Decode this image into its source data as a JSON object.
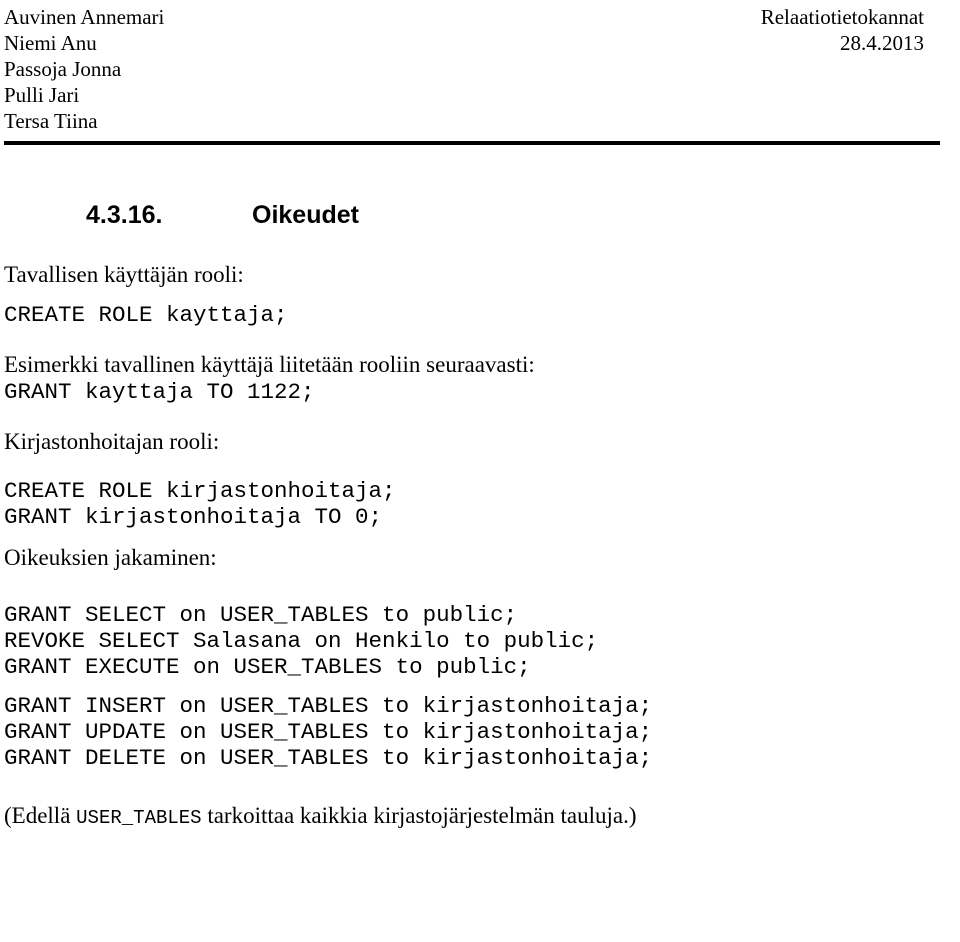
{
  "header": {
    "authors": [
      "Auvinen Annemari",
      "Niemi Anu",
      "Passoja Jonna",
      "Pulli Jari",
      "Tersa Tiina"
    ],
    "course": "Relaatiotietokannat",
    "date": "28.4.2013"
  },
  "section": {
    "number": "4.3.16.",
    "title": "Oikeudet"
  },
  "body": {
    "label_basic_user_role": "Tavallisen käyttäjän rooli:",
    "code_create_role_kayttaja": "CREATE ROLE kayttaja;",
    "label_example_attach": "Esimerkki tavallinen käyttäjä liitetään rooliin seuraavasti:",
    "code_grant_kayttaja": "GRANT kayttaja TO 1122;",
    "label_librarian_role": "Kirjastonhoitajan rooli:",
    "code_create_role_kirjastonhoitaja": "CREATE ROLE kirjastonhoitaja;",
    "code_grant_kirjastonhoitaja": "GRANT kirjastonhoitaja TO 0;",
    "label_granting_rights": "Oikeuksien jakaminen:",
    "code_grant_select_public": "GRANT SELECT on USER_TABLES to public;",
    "code_revoke_select_salasana": "REVOKE SELECT Salasana on Henkilo to public;",
    "code_grant_execute_public": "GRANT EXECUTE on USER_TABLES to public;",
    "code_grant_insert_librarian": "GRANT INSERT on USER_TABLES to kirjastonhoitaja;",
    "code_grant_update_librarian": "GRANT UPDATE on USER_TABLES to kirjastonhoitaja;",
    "code_grant_delete_librarian": "GRANT DELETE on USER_TABLES to kirjastonhoitaja;",
    "note_prefix": "(Edellä ",
    "note_mono": "USER_TABLES",
    "note_suffix": " tarkoittaa kaikkia kirjastojärjestelmän tauluja.)"
  }
}
